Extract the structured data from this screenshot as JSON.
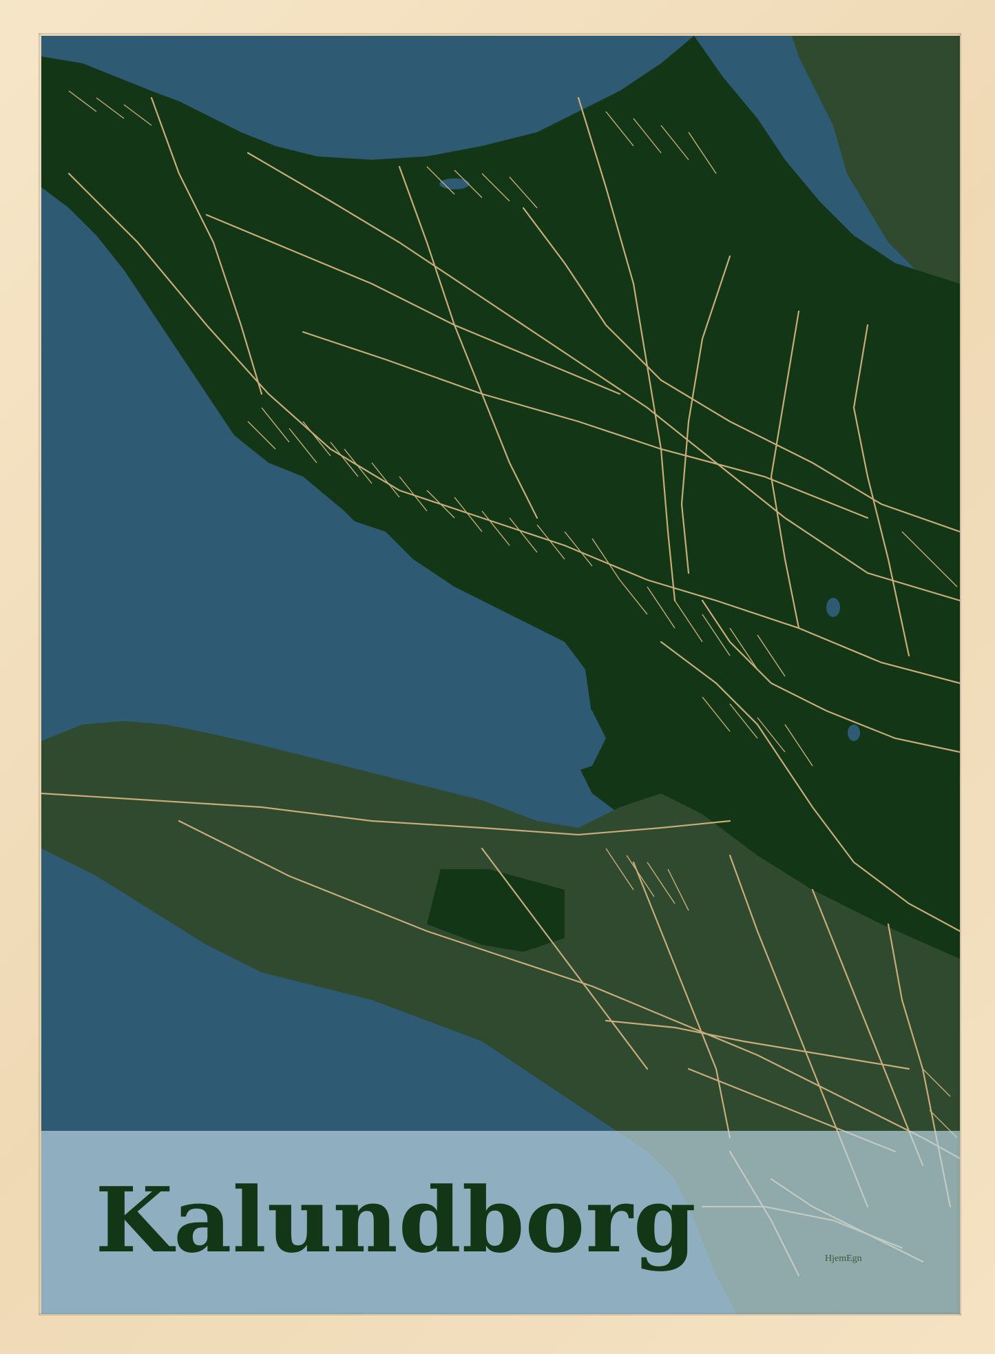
{
  "poster": {
    "title": "Kalundborg",
    "brand": "HjemEgn"
  },
  "colors": {
    "frame": "#f2dfc0",
    "water": "#2e5a73",
    "land_dark": "#123616",
    "land_light": "#2f4a2e",
    "roads": "#c8ad7a",
    "title_band": "#bed7e6",
    "title_text": "#123616"
  }
}
